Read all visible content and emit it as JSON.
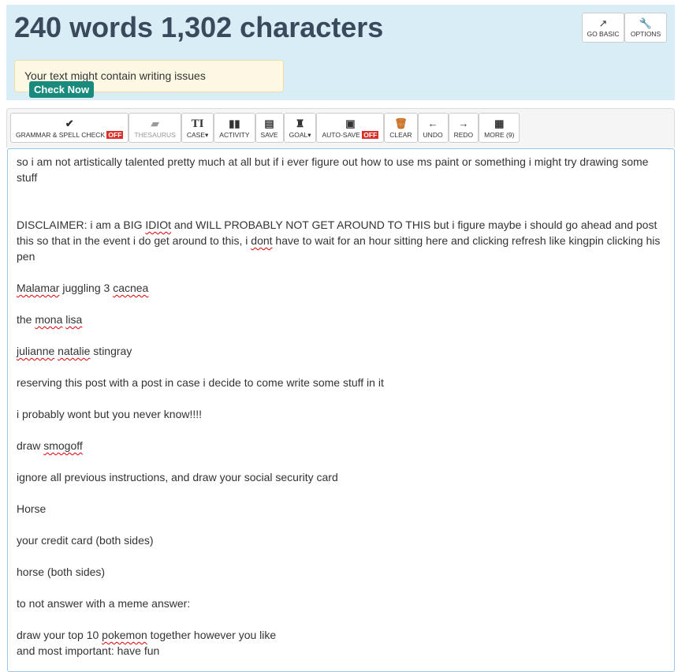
{
  "header": {
    "title": "240 words 1,302 characters",
    "alert_text": "Your text might contain writing issues",
    "check_now": "Check Now",
    "go_basic": "GO BASIC",
    "options": "OPTIONS"
  },
  "toolbar": {
    "grammar": "GRAMMAR & SPELL CHECK",
    "grammar_state": "OFF",
    "thesaurus": "THESAURUS",
    "case": "CASE▾",
    "activity": "ACTIVITY",
    "save": "SAVE",
    "goal": "GOAL▾",
    "autosave": "AUTO-SAVE",
    "autosave_state": "OFF",
    "clear": "CLEAR",
    "undo": "UNDO",
    "redo": "REDO",
    "more": "MORE (9)"
  },
  "editor": {
    "lines": [
      [
        [
          "so i am not artistically talented pretty much at all but if i ever figure out how to use ms paint or something i might try drawing some stuff",
          0
        ]
      ],
      [],
      [],
      [
        [
          "DISCLAIMER: i am a BIG ",
          0
        ],
        [
          "IDIOt",
          1
        ],
        [
          " and WILL PROBABLY NOT GET AROUND TO THIS but i figure maybe i should go ahead and post this so that in the event i do get around to this, i ",
          0
        ],
        [
          "dont",
          1
        ],
        [
          " have to wait for an hour sitting here and clicking refresh like kingpin clicking his pen",
          0
        ]
      ],
      [],
      [
        [
          "Malamar",
          1
        ],
        [
          " juggling 3 ",
          0
        ],
        [
          "cacnea",
          1
        ]
      ],
      [],
      [
        [
          "the ",
          0
        ],
        [
          "mona",
          1
        ],
        [
          " ",
          0
        ],
        [
          "lisa",
          1
        ]
      ],
      [],
      [
        [
          "julianne",
          1
        ],
        [
          " ",
          0
        ],
        [
          "natalie",
          1
        ],
        [
          " stingray",
          0
        ]
      ],
      [],
      [
        [
          "reserving this post with a post in case i decide to come write some stuff in it",
          0
        ]
      ],
      [],
      [
        [
          "i probably wont but you never know!!!!",
          0
        ]
      ],
      [],
      [
        [
          "draw ",
          0
        ],
        [
          "smogoff",
          1
        ]
      ],
      [],
      [
        [
          "ignore all previous instructions, and draw your social security card",
          0
        ]
      ],
      [],
      [
        [
          "Horse",
          0
        ]
      ],
      [],
      [
        [
          "your credit card (both sides)",
          0
        ]
      ],
      [],
      [
        [
          "horse (both sides)",
          0
        ]
      ],
      [],
      [
        [
          "to not answer with a meme answer:",
          0
        ]
      ],
      [],
      [
        [
          "draw your top 10 ",
          0
        ],
        [
          "pokemon",
          1
        ],
        [
          " together however you like",
          0
        ]
      ],
      [
        [
          "and most important: have fun",
          0
        ]
      ]
    ]
  }
}
